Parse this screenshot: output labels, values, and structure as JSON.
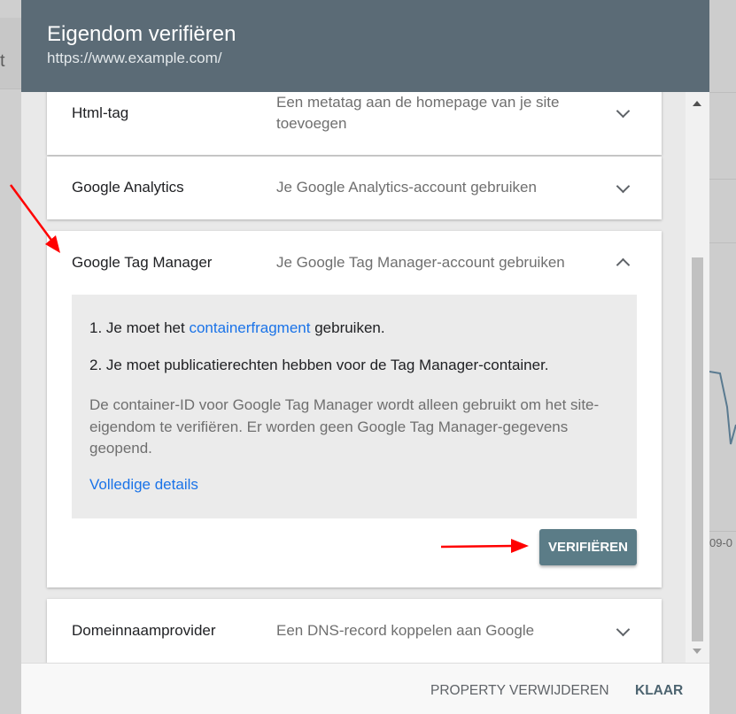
{
  "background": {
    "left_fragment": "t",
    "right_date_fragment": "09-0"
  },
  "dialog": {
    "title": "Eigendom verifiëren",
    "subtitle": "https://www.example.com/"
  },
  "methods": [
    {
      "name": "Html-tag",
      "description": "Een metatag aan de homepage van je site toevoegen",
      "expanded": false
    },
    {
      "name": "Google Analytics",
      "description": "Je Google Analytics-account gebruiken",
      "expanded": false
    },
    {
      "name": "Google Tag Manager",
      "description": "Je Google Tag Manager-account gebruiken",
      "expanded": true,
      "details": {
        "step1_prefix": "1. Je moet het ",
        "step1_link": "containerfragment",
        "step1_suffix": " gebruiken.",
        "step2": "2. Je moet publicatierechten hebben voor de Tag Manager-container.",
        "note": "De container-ID voor Google Tag Manager wordt alleen gebruikt om het site-eigendom te verifiëren. Er worden geen Google Tag Manager-gegevens geopend.",
        "details_link": "Volledige details",
        "verify_label": "VERIFIËREN"
      }
    },
    {
      "name": "Domeinnaamprovider",
      "description": "Een DNS-record koppelen aan Google",
      "expanded": false
    }
  ],
  "footer": {
    "remove_label": "PROPERTY VERWIJDEREN",
    "done_label": "KLAAR"
  },
  "icons": {
    "collapsed": "chevron-down-icon",
    "expanded": "chevron-up-icon",
    "annotation": "red-arrow"
  },
  "colors": {
    "header": "#5b6b76",
    "verify_button": "#5b7c87",
    "link": "#1a73e8",
    "annotation_arrow": "#ff0000"
  }
}
